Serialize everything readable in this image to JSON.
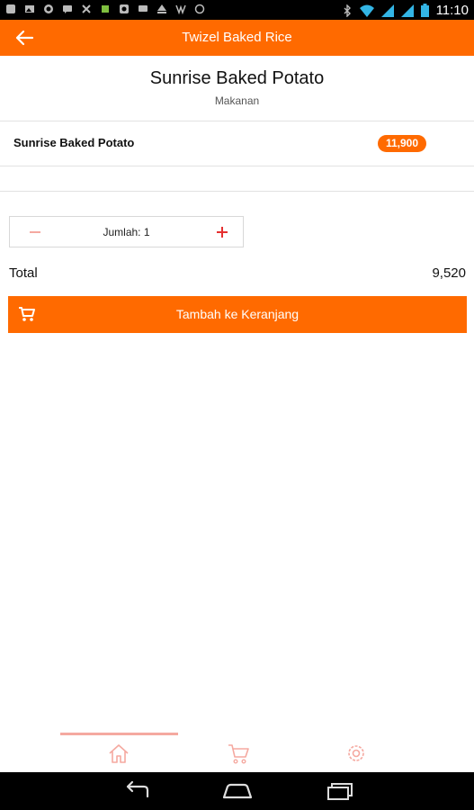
{
  "status_bar": {
    "time": "11:10",
    "icons": [
      "notification-icon",
      "image-icon",
      "whatsapp-icon",
      "chat-icon",
      "tools-icon",
      "app-icon",
      "instagram-icon",
      "chat-icon",
      "upload-icon",
      "download-icon",
      "sync-icon",
      "bluetooth-icon",
      "wifi-icon",
      "signal-icon",
      "signal-icon",
      "battery-icon"
    ]
  },
  "app_bar": {
    "title": "Twizel Baked Rice",
    "back_icon": "arrow-left-icon"
  },
  "product": {
    "title": "Sunrise Baked Potato",
    "category": "Makanan"
  },
  "variant": {
    "name": "Sunrise Baked Potato",
    "price": "11,900"
  },
  "quantity": {
    "label": "Jumlah: 1"
  },
  "total": {
    "label": "Total",
    "value": "9,520"
  },
  "add_to_cart": {
    "label": "Tambah ke Keranjang",
    "icon": "cart-icon"
  },
  "bottom_nav": {
    "items": [
      "home-icon",
      "cart-icon",
      "settings-icon"
    ],
    "active_index": 0
  },
  "colors": {
    "accent": "#ff6a00",
    "nav_inactive": "#f5a9a0"
  }
}
